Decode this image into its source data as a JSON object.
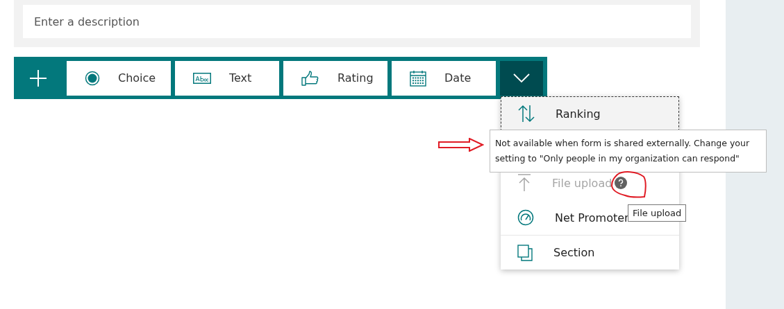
{
  "description": {
    "placeholder": "Enter a description"
  },
  "toolbar": {
    "buttons": [
      {
        "kind": "choice",
        "label": "Choice"
      },
      {
        "kind": "text",
        "label": "Text"
      },
      {
        "kind": "rating",
        "label": "Rating"
      },
      {
        "kind": "date",
        "label": "Date"
      }
    ],
    "more_expanded": true
  },
  "menu": {
    "items": [
      {
        "kind": "ranking",
        "label": "Ranking",
        "highlighted": true,
        "disabled": false,
        "help": false
      },
      {
        "kind": "hidden"
      },
      {
        "kind": "upload",
        "label": "File upload",
        "highlighted": false,
        "disabled": true,
        "help": true
      },
      {
        "kind": "nps",
        "label": "Net Promoter",
        "highlighted": false,
        "disabled": false,
        "help": false
      },
      {
        "kind": "section",
        "label": "Section",
        "highlighted": false,
        "disabled": false,
        "help": false
      }
    ]
  },
  "tooltips": {
    "disabled_reason": "Not available when form is shared externally. Change your setting to \"Only people in my organization can respond\"",
    "hover": "File upload"
  }
}
